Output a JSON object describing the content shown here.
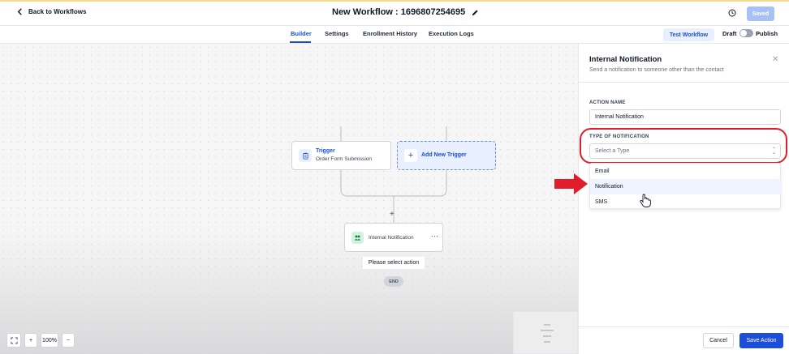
{
  "header": {
    "back_label": "Back to Workflows",
    "workflow_title": "New Workflow : 1696807254695",
    "saved_label": "Saved"
  },
  "tabs": {
    "items": [
      {
        "label": "Builder",
        "active": true
      },
      {
        "label": "Settings",
        "active": false
      },
      {
        "label": "Enrollment History",
        "active": false
      },
      {
        "label": "Execution Logs",
        "active": false
      }
    ],
    "test_workflow_label": "Test Workflow",
    "draft_label": "Draft",
    "publish_label": "Publish",
    "published": false
  },
  "canvas": {
    "trigger": {
      "title": "Trigger",
      "subtitle": "Order Form Submission"
    },
    "add_trigger_label": "Add New Trigger",
    "action": {
      "label": "Internal Notification",
      "more": "···"
    },
    "select_action_label": "Please select action",
    "end_label": "END",
    "zoom_level": "100%"
  },
  "panel": {
    "title": "Internal Notification",
    "subtitle": "Send a notification to someone other than the contact",
    "action_name_label": "ACTION NAME",
    "action_name_value": "Internal Notification",
    "type_label": "TYPE OF NOTIFICATION",
    "type_placeholder": "Select a Type",
    "type_options": [
      "Email",
      "Notification",
      "SMS"
    ],
    "hovered_option": "Notification",
    "cancel_label": "Cancel",
    "save_label": "Save Action"
  },
  "colors": {
    "accent": "#1d4ed8",
    "annotation_red": "#e11d2b",
    "saved_disabled": "#a9c0f5"
  }
}
